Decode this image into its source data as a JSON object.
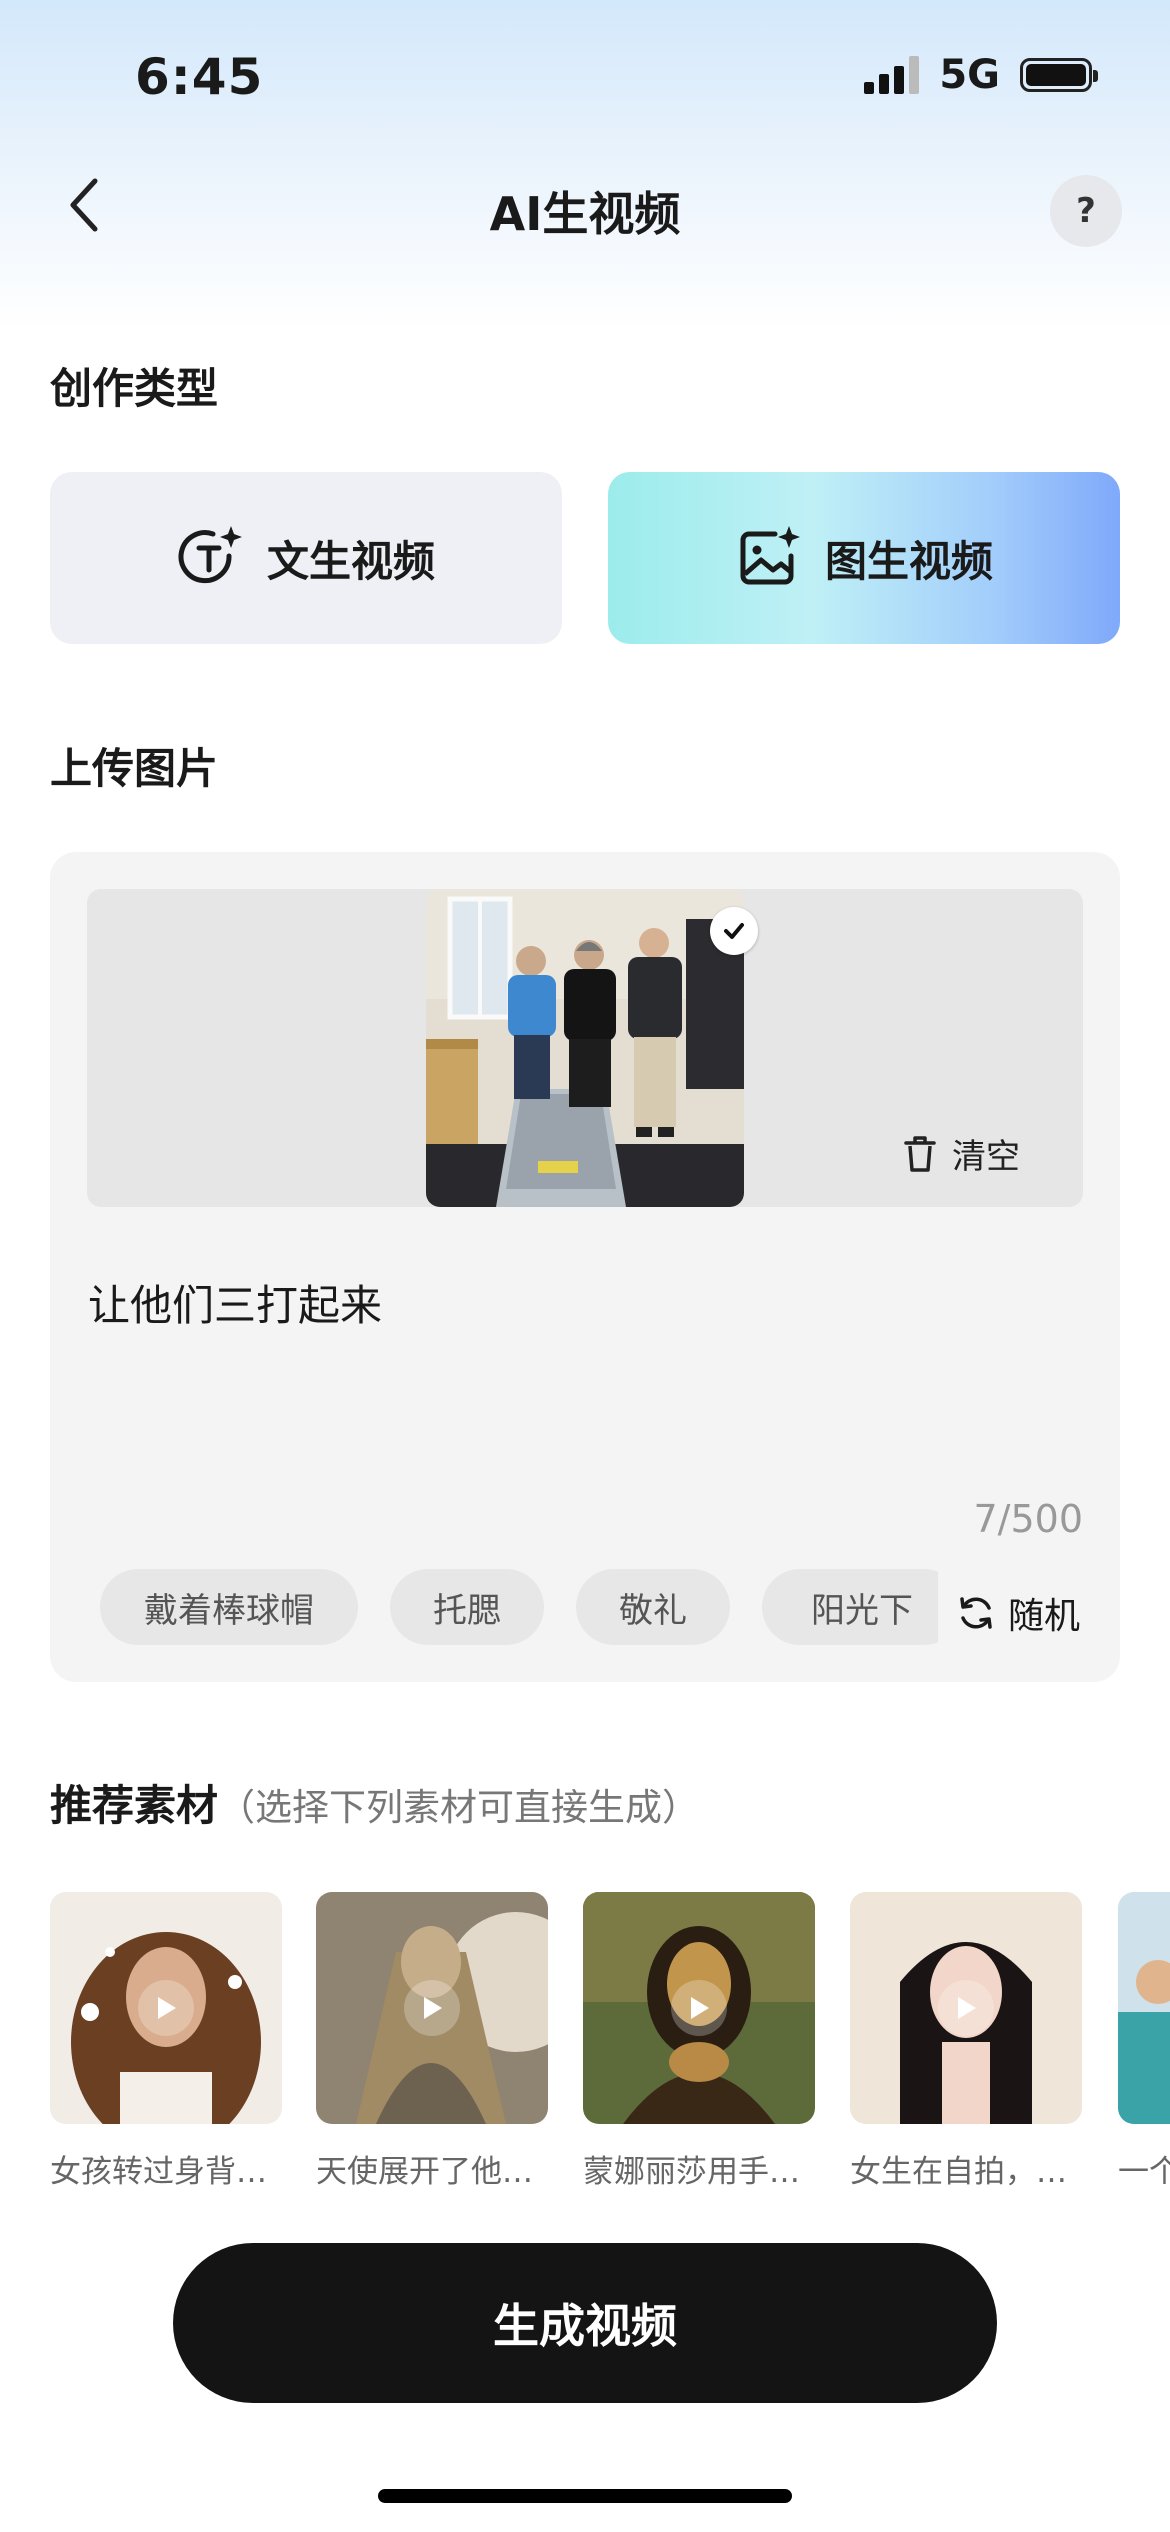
{
  "status_bar": {
    "time": "6:45",
    "network": "5G"
  },
  "header": {
    "title": "AI生视频",
    "help": "?"
  },
  "creation_type": {
    "title": "创作类型",
    "options": [
      {
        "label": "文生视频",
        "icon": "text-sparkle-icon",
        "selected": false
      },
      {
        "label": "图生视频",
        "icon": "image-sparkle-icon",
        "selected": true
      }
    ]
  },
  "upload": {
    "title": "上传图片",
    "clear_label": "清空",
    "prompt": "让他们三打起来",
    "char_count": "7/500",
    "chips": [
      "戴着棒球帽",
      "托腮",
      "敬礼",
      "阳光下"
    ],
    "random_label": "随机"
  },
  "materials": {
    "title": "推荐素材",
    "note": "（选择下列素材可直接生成）",
    "items": [
      {
        "caption": "女孩转过身背对镜头"
      },
      {
        "caption": "天使展开了他的翅膀"
      },
      {
        "caption": "蒙娜丽莎用手遮住脸"
      },
      {
        "caption": "女生在自拍，微笑着"
      },
      {
        "caption": "一个"
      }
    ]
  },
  "generate_button": "生成视频",
  "colors": {
    "accent_gradient_start": "#9cecec",
    "accent_gradient_end": "#7fa9fa",
    "button_dark": "#141414"
  }
}
